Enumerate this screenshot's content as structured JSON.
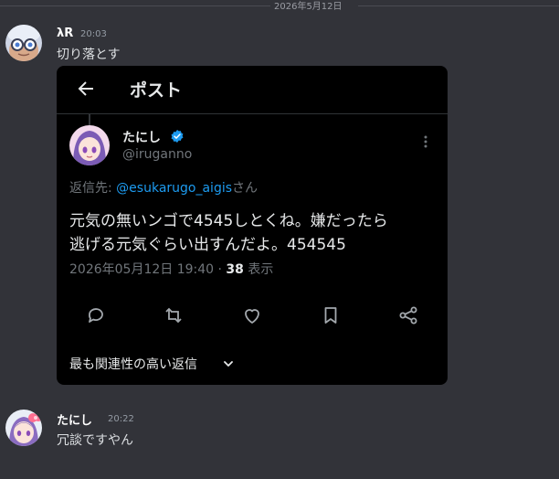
{
  "date_divider": "2026年5月12日",
  "messages": [
    {
      "username": "λR",
      "time": "20:03",
      "text": "切り落とす"
    },
    {
      "username": "たにし",
      "time": "20:22",
      "text": "冗談ですやん"
    }
  ],
  "embed": {
    "header_title": "ポスト",
    "display_name": "たにし",
    "handle": "@iruganno",
    "reply_prefix": "返信先: ",
    "reply_mention": "@esukarugo_aigis",
    "reply_suffix": "さん",
    "body_line1": "元気の無いンゴで4545しとくね。嫌だったら",
    "body_line2": "逃げる元気ぐらい出すんだよ。454545",
    "timestamp": "2026年05月12日 19:40 · ",
    "views_count": "38",
    "views_label": " 表示",
    "most_relevant": "最も関連性の高い返信"
  },
  "icons": [
    "back-arrow-icon",
    "verified-badge-icon",
    "more-options-icon",
    "reply-icon",
    "repost-icon",
    "like-icon",
    "bookmark-icon",
    "share-icon",
    "chevron-down-icon"
  ],
  "colors": {
    "background": "#323339",
    "embed_bg": "#000000",
    "link_blue": "#1d9bf0",
    "muted": "#71767b"
  }
}
